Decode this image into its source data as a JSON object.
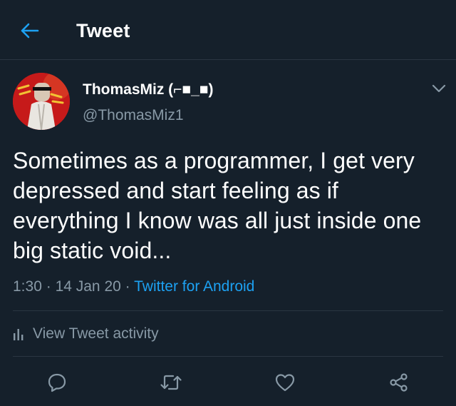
{
  "header": {
    "title": "Tweet",
    "back_icon": "back-arrow-icon",
    "back_color": "#1da1f2"
  },
  "tweet": {
    "author": {
      "display_name": "ThomasMiz (⌐■_■)",
      "username": "@ThomasMiz1"
    },
    "text": "Sometimes as a programmer, I get very depressed and start feeling as if everything I know was all just inside one big static void...",
    "time": "1:30",
    "separator": "·",
    "date": "14 Jan 20",
    "source": "Twitter for Android"
  },
  "activity": {
    "label": "View Tweet activity",
    "icon": "bar-chart-icon"
  },
  "actions": [
    {
      "name": "reply",
      "icon": "reply-icon"
    },
    {
      "name": "retweet",
      "icon": "retweet-icon"
    },
    {
      "name": "like",
      "icon": "heart-icon"
    },
    {
      "name": "share",
      "icon": "share-icon"
    }
  ],
  "colors": {
    "background": "#15202b",
    "text_primary": "#ffffff",
    "text_secondary": "#8899a6",
    "accent": "#1da1f2",
    "divider": "#2a3642"
  }
}
